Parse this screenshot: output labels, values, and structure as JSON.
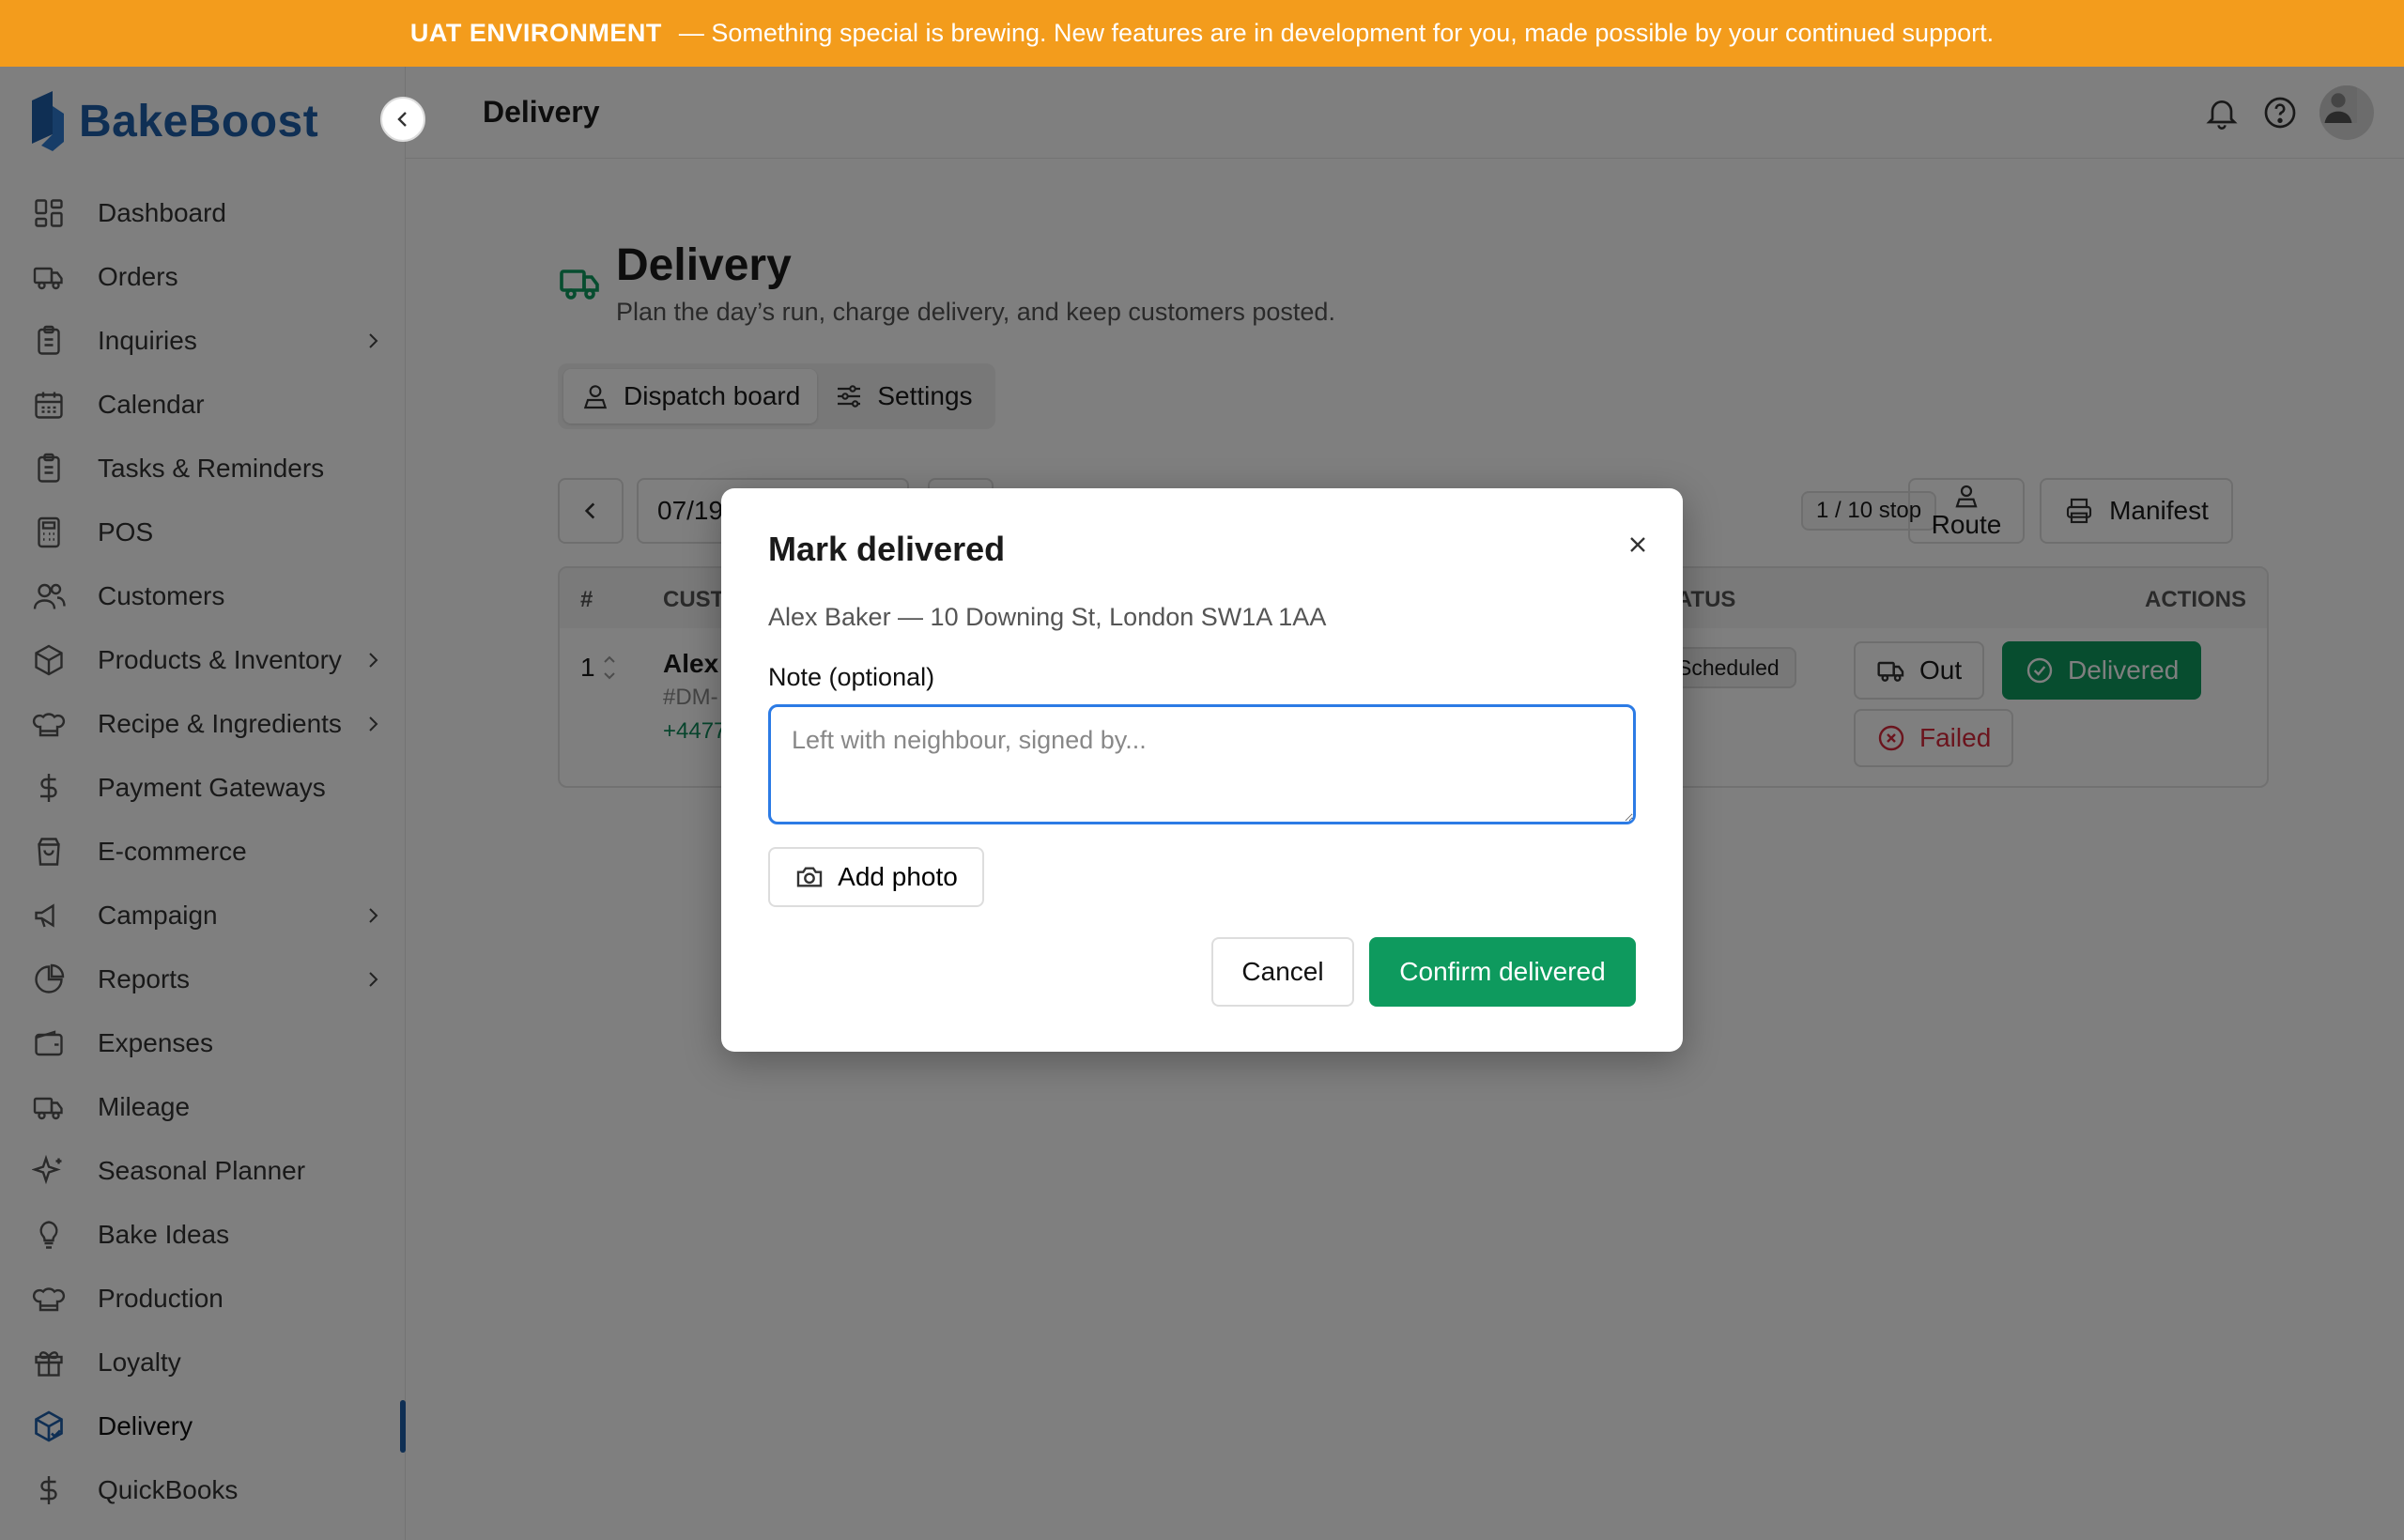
{
  "banner": {
    "env_label": "UAT ENVIRONMENT",
    "message": "— Something special is brewing. New features are in development for you, made possible by your continued support."
  },
  "brand": {
    "name": "BakeBoost"
  },
  "sidebar": {
    "items": [
      {
        "label": "Dashboard",
        "icon": "dashboard-icon",
        "has_submenu": false
      },
      {
        "label": "Orders",
        "icon": "truck-icon",
        "has_submenu": false
      },
      {
        "label": "Inquiries",
        "icon": "clipboard-icon",
        "has_submenu": true
      },
      {
        "label": "Calendar",
        "icon": "calendar-icon",
        "has_submenu": false
      },
      {
        "label": "Tasks & Reminders",
        "icon": "clipboard-icon",
        "has_submenu": false
      },
      {
        "label": "POS",
        "icon": "calculator-icon",
        "has_submenu": false
      },
      {
        "label": "Customers",
        "icon": "users-icon",
        "has_submenu": false
      },
      {
        "label": "Products & Inventory",
        "icon": "box-icon",
        "has_submenu": true
      },
      {
        "label": "Recipe & Ingredients",
        "icon": "chef-hat-icon",
        "has_submenu": true
      },
      {
        "label": "Payment Gateways",
        "icon": "dollar-icon",
        "has_submenu": false
      },
      {
        "label": "E-commerce",
        "icon": "shopping-bag-icon",
        "has_submenu": false
      },
      {
        "label": "Campaign",
        "icon": "megaphone-icon",
        "has_submenu": true
      },
      {
        "label": "Reports",
        "icon": "pie-chart-icon",
        "has_submenu": true
      },
      {
        "label": "Expenses",
        "icon": "wallet-icon",
        "has_submenu": false
      },
      {
        "label": "Mileage",
        "icon": "truck-icon",
        "has_submenu": false
      },
      {
        "label": "Seasonal Planner",
        "icon": "sparkles-icon",
        "has_submenu": false
      },
      {
        "label": "Bake Ideas",
        "icon": "lightbulb-icon",
        "has_submenu": false
      },
      {
        "label": "Production",
        "icon": "chef-hat-icon",
        "has_submenu": false
      },
      {
        "label": "Loyalty",
        "icon": "gift-icon",
        "has_submenu": false
      },
      {
        "label": "Delivery",
        "icon": "package-check-icon",
        "has_submenu": false,
        "active": true
      },
      {
        "label": "QuickBooks",
        "icon": "dollar-icon",
        "has_submenu": false
      }
    ]
  },
  "topbar": {
    "title": "Delivery"
  },
  "page": {
    "title": "Delivery",
    "subtitle": "Plan the day’s run, charge delivery, and keep customers posted.",
    "tabs": [
      {
        "label": "Dispatch board",
        "active": true
      },
      {
        "label": "Settings",
        "active": false
      }
    ]
  },
  "toolbar": {
    "date_value": "07/19",
    "stop_count": "1 / 10 stop",
    "route_label": "Route",
    "manifest_label": "Manifest"
  },
  "table": {
    "headers": {
      "num": "#",
      "customer": "CUST",
      "status": "TATUS",
      "actions": "ACTIONS"
    },
    "rows": [
      {
        "num": "1",
        "customer": "Alex",
        "order_id": "#DM-",
        "phone": "+4477",
        "status": "Scheduled",
        "actions": {
          "out": "Out",
          "delivered": "Delivered",
          "failed": "Failed"
        }
      }
    ]
  },
  "modal": {
    "title": "Mark delivered",
    "address": "Alex Baker — 10 Downing St, London SW1A 1AA",
    "note_label": "Note (optional)",
    "note_placeholder": "Left with neighbour, signed by...",
    "note_value": "",
    "add_photo_label": "Add photo",
    "cancel_label": "Cancel",
    "confirm_label": "Confirm delivered"
  },
  "colors": {
    "banner": "#f39c1c",
    "brand": "#1f5fa8",
    "success": "#0e9a5e",
    "danger": "#d6283b",
    "focus": "#2c7be5"
  }
}
